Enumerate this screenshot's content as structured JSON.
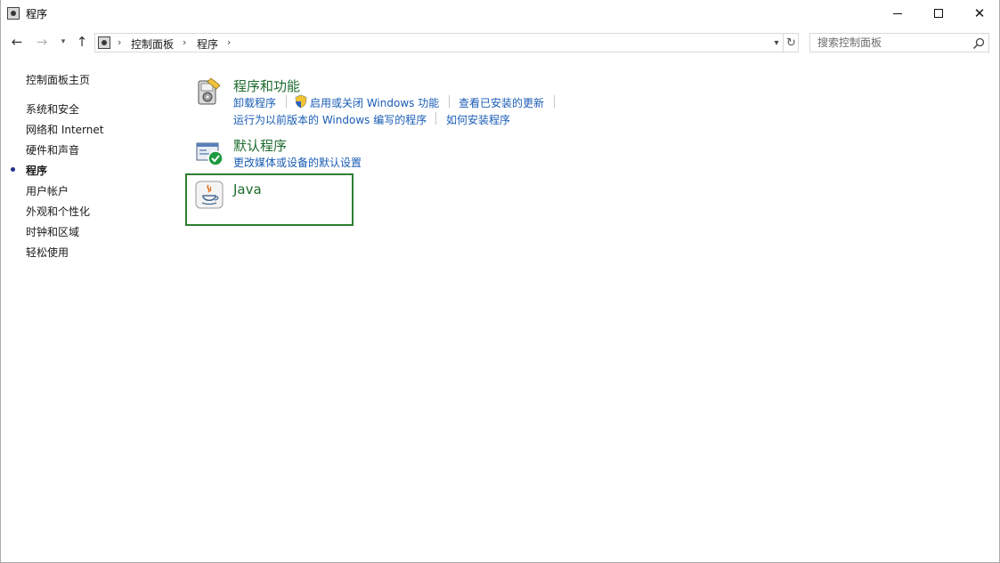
{
  "window": {
    "title": "程序",
    "title_icon": "control-panel-icon",
    "controls": {
      "minimize_icon": "minimize-icon",
      "maximize_icon": "maximize-icon",
      "close_icon": "close-icon"
    }
  },
  "nav": {
    "back_icon": "arrow-left-icon",
    "forward_icon": "arrow-right-icon",
    "recent_icon": "chevron-down-icon",
    "up_icon": "arrow-up-icon"
  },
  "address": {
    "breadcrumbs": [
      "控制面板",
      "程序"
    ],
    "separator": "›",
    "refresh_icon": "refresh-icon",
    "dropdown_icon": "chevron-down-icon"
  },
  "search": {
    "placeholder": "搜索控制面板",
    "icon": "search-icon"
  },
  "sidebar": {
    "home": "控制面板主页",
    "items": [
      {
        "label": "系统和安全",
        "active": false
      },
      {
        "label": "网络和 Internet",
        "active": false
      },
      {
        "label": "硬件和声音",
        "active": false
      },
      {
        "label": "程序",
        "active": true
      },
      {
        "label": "用户帐户",
        "active": false
      },
      {
        "label": "外观和个性化",
        "active": false
      },
      {
        "label": "时钟和区域",
        "active": false
      },
      {
        "label": "轻松使用",
        "active": false
      }
    ]
  },
  "categories": {
    "programs_features": {
      "title": "程序和功能",
      "icon": "programs-features-icon",
      "links": [
        "卸载程序",
        "启用或关闭 Windows 功能",
        "查看已安装的更新",
        "运行为以前版本的 Windows 编写的程序",
        "如何安装程序"
      ],
      "shield_icon": "uac-shield-icon"
    },
    "default_programs": {
      "title": "默认程序",
      "icon": "default-programs-icon",
      "links": [
        "更改媒体或设备的默认设置"
      ]
    },
    "java": {
      "title": "Java",
      "icon": "java-icon"
    }
  },
  "colors": {
    "category_title": "#1e6b2e",
    "link": "#1a5cb5",
    "highlight_border": "#2e7d32"
  }
}
